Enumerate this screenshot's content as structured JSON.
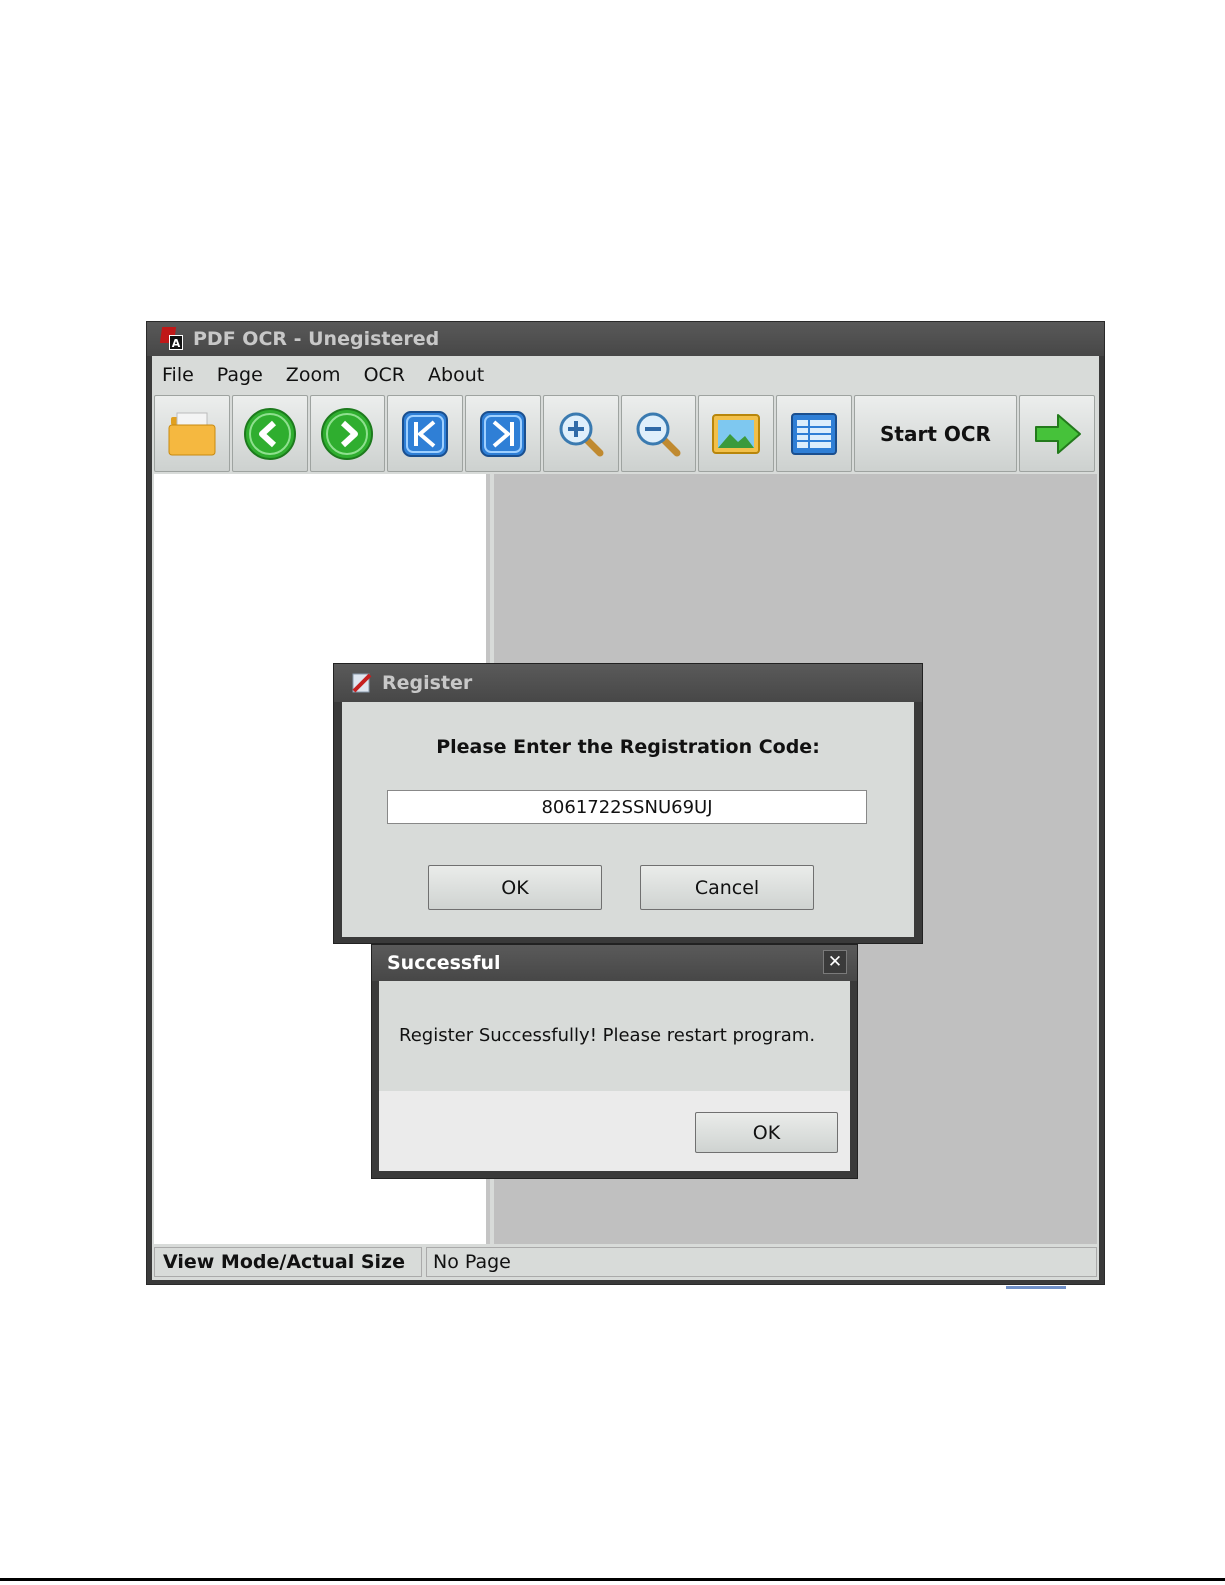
{
  "app": {
    "title": "PDF OCR - Unegistered",
    "menu": [
      "File",
      "Page",
      "Zoom",
      "OCR",
      "About"
    ],
    "toolbar": {
      "icons": [
        "folder-icon",
        "back-arrow-icon",
        "forward-arrow-icon",
        "first-page-icon",
        "last-page-icon",
        "zoom-in-icon",
        "zoom-out-icon",
        "image-icon",
        "table-icon",
        "next-arrow-icon"
      ],
      "start_ocr_label": "Start OCR"
    },
    "status": {
      "mode": "View Mode/Actual Size",
      "page": "No Page"
    }
  },
  "register_dialog": {
    "title": "Register",
    "prompt": "Please Enter the Registration Code:",
    "code_value": "8061722SSNU69UJ",
    "ok_label": "OK",
    "cancel_label": "Cancel"
  },
  "success_dialog": {
    "title": "Successful",
    "close_glyph": "✕",
    "message": "Register Successfully! Please restart program.",
    "ok_label": "OK"
  },
  "colors": {
    "titlebar": "#4f4f4f",
    "client": "#d8dbd9",
    "viewer_bg": "#c0c0c0",
    "green_button": "#2fae2f",
    "blue_button": "#2f7fd6"
  }
}
